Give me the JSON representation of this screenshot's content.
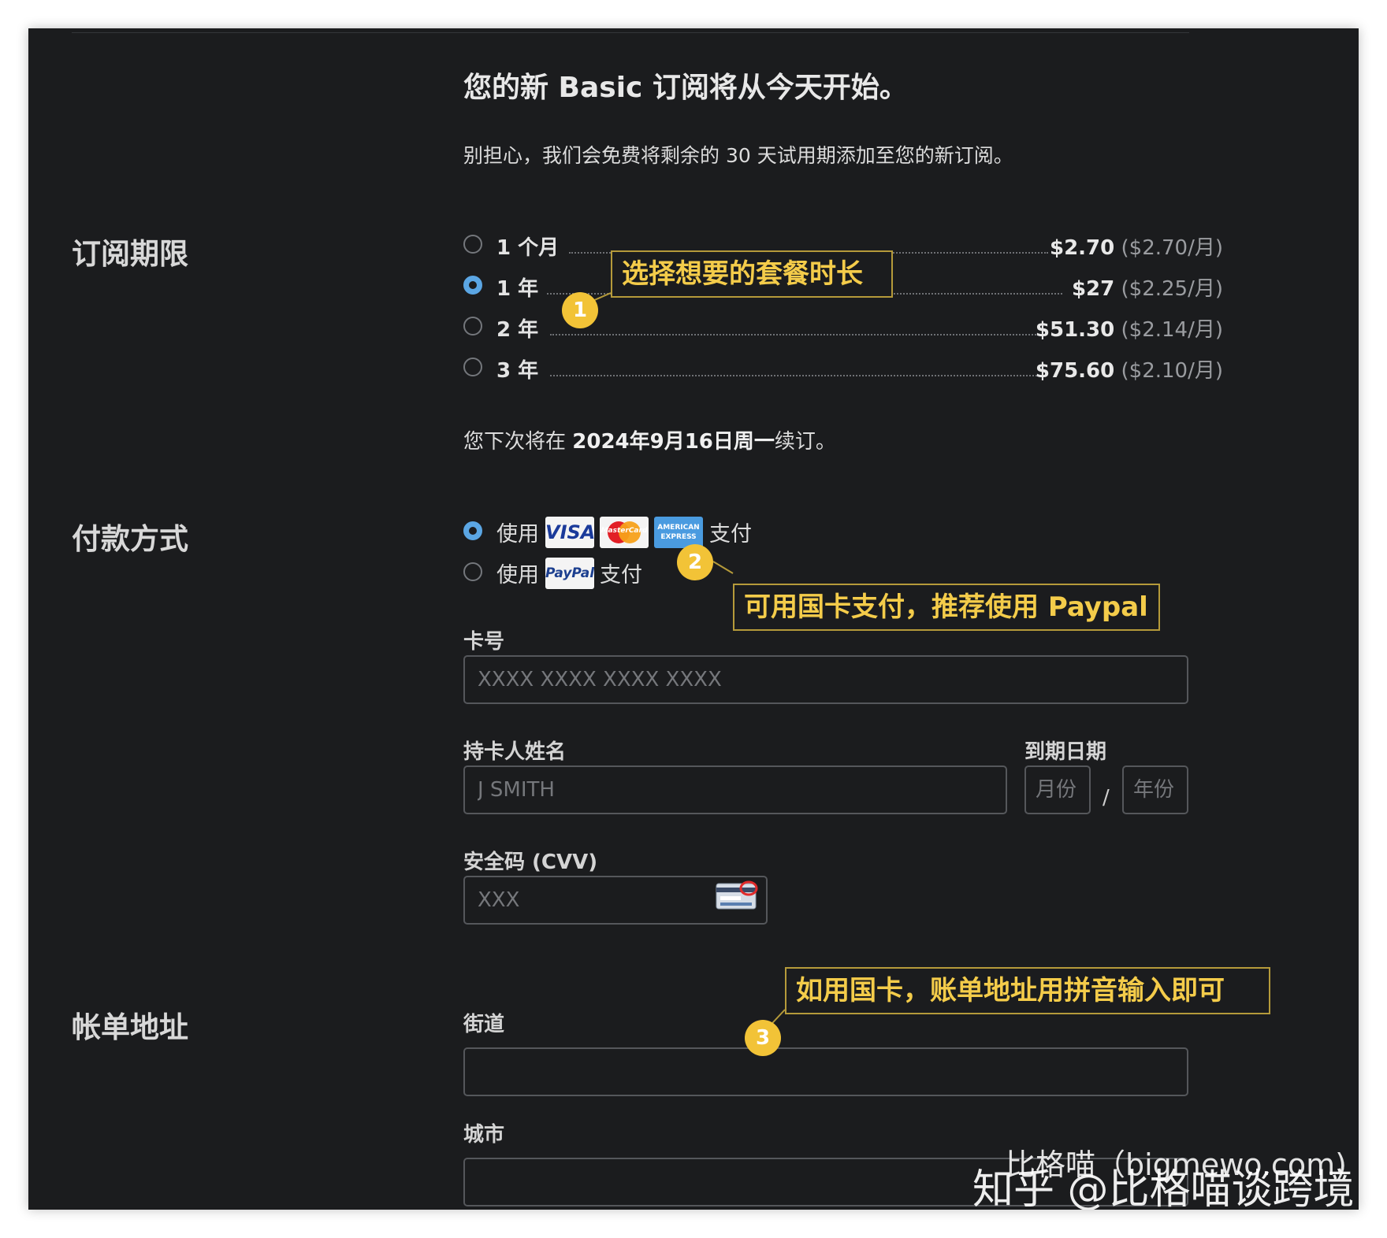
{
  "header": {
    "title": "您的新 Basic 订阅将从今天开始。",
    "subtitle": "别担心，我们会免费将剩余的 30 天试用期添加至您的新订阅。"
  },
  "subscription": {
    "section_title": "订阅期限",
    "plans": [
      {
        "label": "1 个月",
        "price": "$2.70",
        "per_month": "($2.70/月)",
        "selected": false
      },
      {
        "label": "1 年",
        "price": "$27",
        "per_month": "($2.25/月)",
        "selected": true
      },
      {
        "label": "2 年",
        "price": "$51.30",
        "per_month": "($2.14/月)",
        "selected": false
      },
      {
        "label": "3 年",
        "price": "$75.60",
        "per_month": "($2.10/月)",
        "selected": false
      }
    ],
    "renewal_prefix": "您下次将在 ",
    "renewal_date": "2024年9月16日周一",
    "renewal_suffix": "续订。"
  },
  "payment": {
    "section_title": "付款方式",
    "card_option": {
      "prefix": "使用",
      "suffix": "支付",
      "selected": true,
      "logos": [
        "VISA",
        "MasterCard",
        "AMERICAN EXPRESS"
      ]
    },
    "paypal_option": {
      "prefix": "使用",
      "suffix": "支付",
      "selected": false,
      "logo": "PayPal"
    },
    "card_number": {
      "label": "卡号",
      "value": "",
      "placeholder": "XXXX XXXX XXXX XXXX"
    },
    "cardholder": {
      "label": "持卡人姓名",
      "value": "",
      "placeholder": "J SMITH"
    },
    "expiry": {
      "label": "到期日期",
      "month_placeholder": "月份",
      "year_placeholder": "年份",
      "separator": "/"
    },
    "cvv": {
      "label": "安全码 (CVV)",
      "value": "",
      "placeholder": "XXX",
      "icon": "card-cvv-icon"
    }
  },
  "billing": {
    "section_title": "帐单地址",
    "street": {
      "label": "街道",
      "value": ""
    },
    "city": {
      "label": "城市",
      "value": ""
    }
  },
  "annotations": {
    "callout_1": "选择想要的套餐时长",
    "callout_2": "可用国卡支付，推荐使用 Paypal",
    "callout_3": "如用国卡，账单地址用拼音输入即可",
    "badge_1": "1",
    "badge_2": "2",
    "badge_3": "3",
    "color": "#f2c337"
  },
  "watermark": {
    "line1": "比格喵（bigmewo.com)",
    "line2": "知乎 @比格喵谈跨境"
  },
  "colors": {
    "background": "#1b1c1e",
    "accent": "#5ba6e4",
    "callout": "#f4cc4a"
  }
}
